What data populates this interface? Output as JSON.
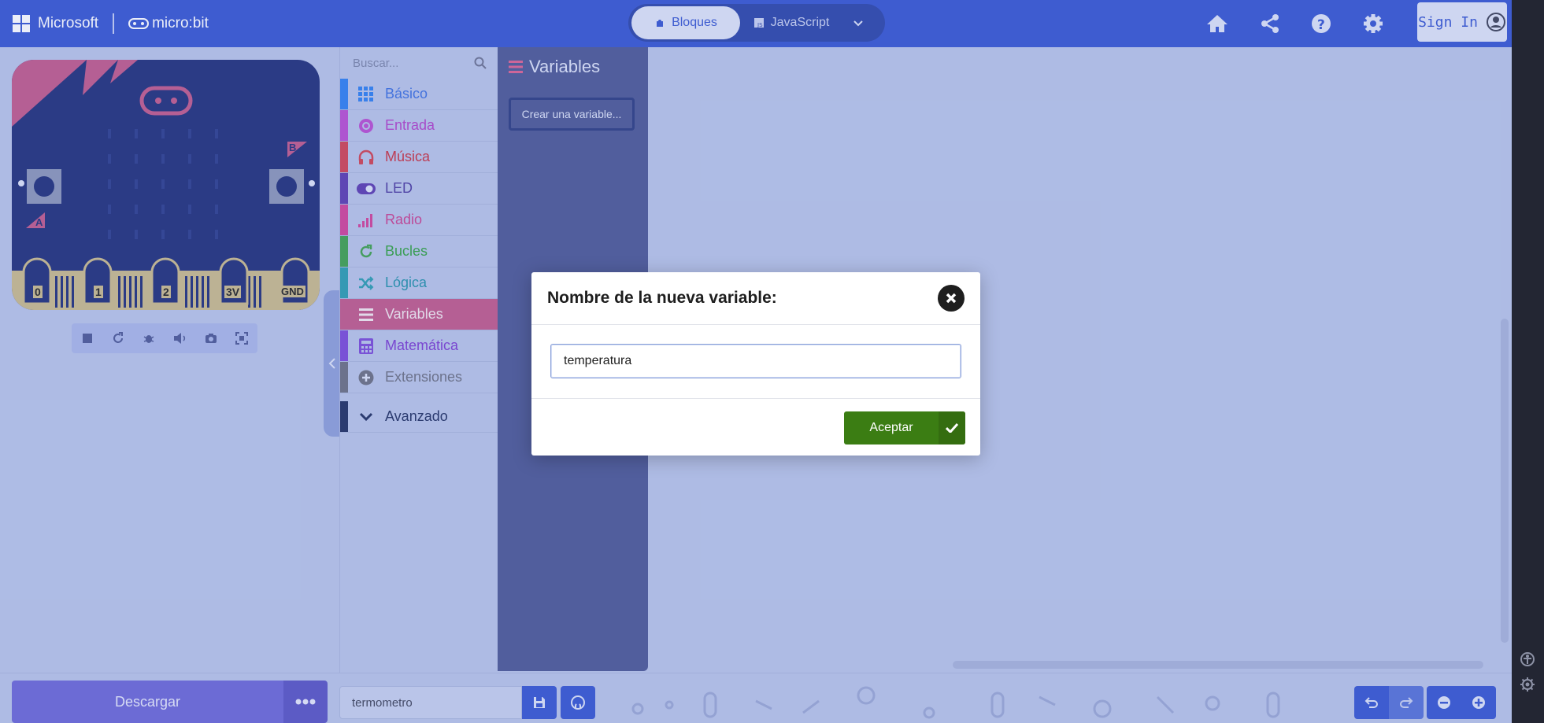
{
  "header": {
    "microsoft_label": "Microsoft",
    "microbit_label": "micro:bit",
    "tab_blocks": "Bloques",
    "tab_js": "JavaScript",
    "signin_label": "Sign In"
  },
  "simulator": {
    "pins": [
      "0",
      "1",
      "2",
      "3V",
      "GND"
    ],
    "button_a": "A",
    "button_b": "B",
    "controls": [
      "stop-icon",
      "restart-icon",
      "debug-icon",
      "mute-icon",
      "screenshot-icon",
      "fullscreen-icon"
    ]
  },
  "toolbox": {
    "search_placeholder": "Buscar...",
    "categories": [
      {
        "label": "Básico",
        "color": "#1e90ff",
        "icon": "grid-icon"
      },
      {
        "label": "Entrada",
        "color": "#d400d4",
        "icon": "target-icon"
      },
      {
        "label": "Música",
        "color": "#e63022",
        "icon": "headphones-icon"
      },
      {
        "label": "LED",
        "color": "#5c2d91",
        "icon": "toggle-icon"
      },
      {
        "label": "Radio",
        "color": "#e3008c",
        "icon": "signal-icon"
      },
      {
        "label": "Bucles",
        "color": "#00aa00",
        "icon": "refresh-icon"
      },
      {
        "label": "Lógica",
        "color": "#00a4a6",
        "icon": "shuffle-icon"
      },
      {
        "label": "Variables",
        "color": "#dc143c",
        "icon": "list-icon"
      },
      {
        "label": "Matemática",
        "color": "#9400d3",
        "icon": "calculator-icon"
      },
      {
        "label": "Extensiones",
        "color": "#7f7f7f",
        "icon": "plus-circle-icon"
      }
    ],
    "advanced_label": "Avanzado"
  },
  "flyout": {
    "title": "Variables",
    "create_variable_label": "Crear una variable..."
  },
  "modal": {
    "title": "Nombre de la nueva variable:",
    "input_value": "temperatura",
    "accept_label": "Aceptar"
  },
  "bottom": {
    "download_label": "Descargar",
    "project_name": "termometro"
  }
}
